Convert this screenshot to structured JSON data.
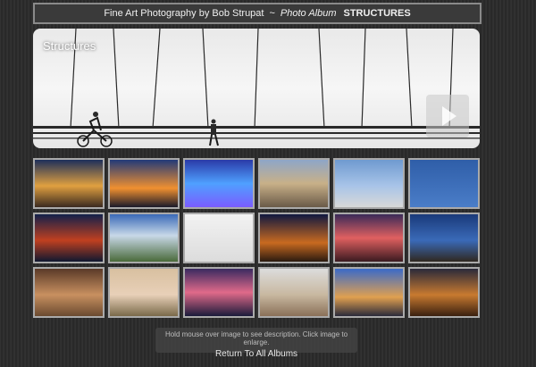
{
  "header": {
    "site_title": "Fine Art Photography by Bob Strupat",
    "separator": "~",
    "album_label": "Photo Album",
    "current_album": "STRUCTURES"
  },
  "slideshow": {
    "title": "Structures",
    "play_icon": "play-icon"
  },
  "thumbnails": [
    {
      "name": "thumb-bridge-arches",
      "bg": "linear-gradient(180deg,#1d2f5a 0%,#e0a040 55%,#3a2a20 100%)"
    },
    {
      "name": "thumb-bridge-night-lights",
      "bg": "linear-gradient(180deg,#223a78 0%,#f09030 60%,#1a1a2a 100%)"
    },
    {
      "name": "thumb-neon-hotel",
      "bg": "linear-gradient(180deg,#2a3aa8 0%,#4fa0ff 50%,#7a5cff 100%)"
    },
    {
      "name": "thumb-ornate-building",
      "bg": "linear-gradient(180deg,#8ea6c8 0%,#c8b088 50%,#6a5a48 100%)"
    },
    {
      "name": "thumb-space-needle",
      "bg": "linear-gradient(180deg,#6f9ad0 0%,#a8c4e8 55%,#d8d8d8 100%)"
    },
    {
      "name": "thumb-blue-sky-tower",
      "bg": "linear-gradient(180deg,#2f5ea8 0%,#4a7dc8 100%)"
    },
    {
      "name": "thumb-golden-gate-night",
      "bg": "linear-gradient(180deg,#12204a 0%,#c04020 55%,#101830 100%)"
    },
    {
      "name": "thumb-coastal-bridge",
      "bg": "linear-gradient(180deg,#3a6ab8 0%,#c8d8e8 45%,#4a6a3a 100%)"
    },
    {
      "name": "thumb-bridge-cables",
      "bg": "linear-gradient(180deg,#f2f2f2 0%,#dcdcdc 100%)"
    },
    {
      "name": "thumb-eiffel-vegas",
      "bg": "linear-gradient(180deg,#101840 0%,#c86a20 60%,#2a1a10 100%)"
    },
    {
      "name": "thumb-casino-lights",
      "bg": "linear-gradient(180deg,#3a2a58 0%,#e06060 50%,#3a1a20 100%)"
    },
    {
      "name": "thumb-church-dusk",
      "bg": "linear-gradient(180deg,#1a3a7a 0%,#3a6ab8 55%,#302820 100%)"
    },
    {
      "name": "thumb-cathedral-interior",
      "bg": "linear-gradient(180deg,#5a3a28 0%,#c89060 55%,#6a4a30 100%)"
    },
    {
      "name": "thumb-lighthouse-marsh",
      "bg": "linear-gradient(180deg,#d8c0a0 0%,#e8d0b8 55%,#7a6a4a 100%)"
    },
    {
      "name": "thumb-lighthouse-storm",
      "bg": "linear-gradient(180deg,#3a2a60 0%,#e06a8a 50%,#1a1a3a 100%)"
    },
    {
      "name": "thumb-cliff-house",
      "bg": "linear-gradient(180deg,#dcdcdc 0%,#c8b8a0 55%,#8a7058 100%)"
    },
    {
      "name": "thumb-palm-castle",
      "bg": "linear-gradient(180deg,#3a6ac8 0%,#e0a050 60%,#2a2a3a 100%)"
    },
    {
      "name": "thumb-palace-night",
      "bg": "linear-gradient(180deg,#2a2a3a 0%,#c87a30 55%,#3a2010 100%)"
    }
  ],
  "footer": {
    "hint": "Hold mouse over image to see description. Click image to enlarge.",
    "back_link": "Return To All Albums"
  }
}
